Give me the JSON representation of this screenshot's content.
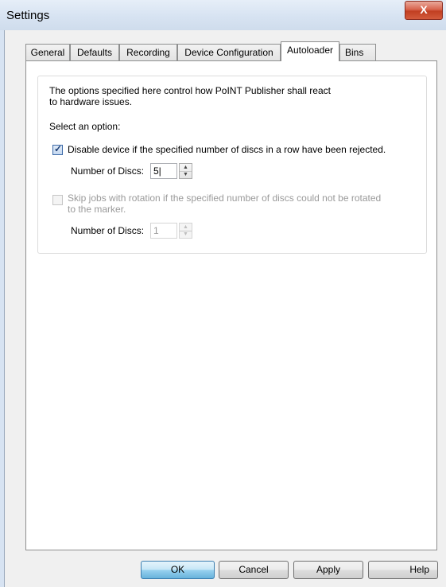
{
  "window": {
    "title": "Settings",
    "close_label": "X"
  },
  "tabs": [
    "General",
    "Defaults",
    "Recording",
    "Device Configuration",
    "Autoloader",
    "Bins"
  ],
  "active_tab": "Autoloader",
  "autoloader": {
    "intro_line1": "The options specified here control how PoINT Publisher shall react",
    "intro_line2": "to hardware issues.",
    "select_prompt": "Select an option:",
    "option1": {
      "label": "Disable device if the specified number of discs in a row have been rejected.",
      "checked": true,
      "enabled": true,
      "number_label": "Number of Discs:",
      "number_value": "5|"
    },
    "option2": {
      "label_line1": "Skip jobs with rotation if the specified number of discs could not be rotated",
      "label_line2": "to the marker.",
      "checked": false,
      "enabled": false,
      "number_label": "Number of Discs:",
      "number_value": "1"
    }
  },
  "buttons": {
    "ok": "OK",
    "cancel": "Cancel",
    "apply": "Apply",
    "help": "Help"
  },
  "colors": {
    "accent": "#3c7fb1",
    "close": "#c13f22",
    "disabled_text": "#9a9a9a"
  }
}
